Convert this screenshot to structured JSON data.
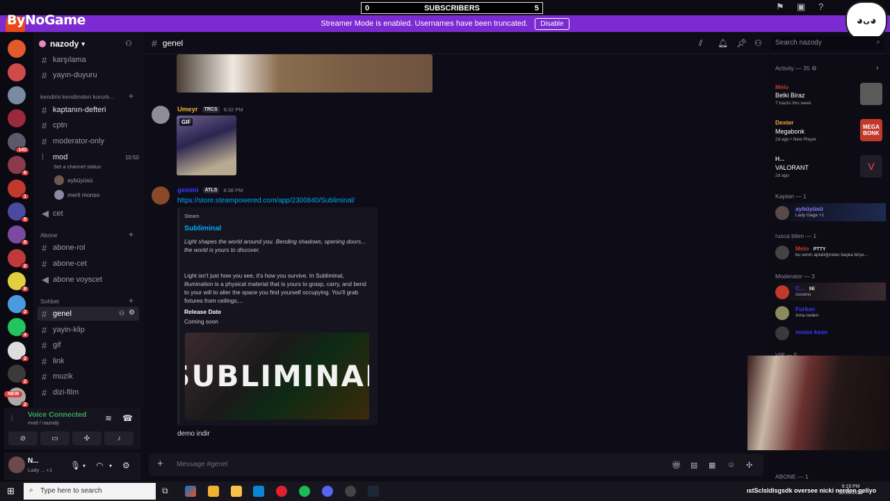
{
  "overlay": {
    "subs_left": "0",
    "subs_label": "SUBSCRIBERS",
    "subs_right": "5",
    "brand": "ByNoGame"
  },
  "banner": {
    "text": "Streamer Mode is enabled. Usernames have been truncated.",
    "button": "Disable"
  },
  "server_badges": [
    "143",
    "6",
    "1",
    "8",
    "8",
    "2",
    "8",
    "2",
    "4",
    "2",
    "2",
    "2"
  ],
  "server_new": "NEW",
  "guild": {
    "name": "nazody"
  },
  "channels": {
    "top": [
      {
        "name": "karşılama"
      },
      {
        "name": "yayın-duyuru"
      }
    ],
    "cat1": "kendimi kendimden korurk...",
    "cat1_items": [
      {
        "name": "kaptanın-defteri"
      },
      {
        "name": "cptn"
      },
      {
        "name": "moderator-only"
      },
      {
        "name": "mod",
        "time": "10:50",
        "status": "Set a channel status"
      }
    ],
    "voice_users": [
      {
        "name": "aybüyüsü"
      },
      {
        "name": "merli monso"
      }
    ],
    "cet": "cet",
    "cat2": "Abone",
    "cat2_items": [
      {
        "name": "abone-rol"
      },
      {
        "name": "abone-cet"
      },
      {
        "name": "abone voyscet"
      }
    ],
    "cat3": "Sohbet",
    "cat3_items": [
      {
        "name": "genel"
      },
      {
        "name": "yayin-klip"
      },
      {
        "name": "gif"
      },
      {
        "name": "link"
      },
      {
        "name": "muzik"
      },
      {
        "name": "dizi-film"
      }
    ]
  },
  "voice": {
    "title": "Voice Connected",
    "sub": "mod / nazody"
  },
  "user": {
    "name": "N...",
    "status": "Lady ... +1"
  },
  "chat": {
    "channel": "genel",
    "messages": [
      {
        "author": "Umeyr",
        "tag": "TRCS",
        "time": "8:32 PM",
        "gif_label": "GIF",
        "color": "#f0b232"
      },
      {
        "author": "gemini",
        "tag": "ATLS",
        "time": "8:38 PM",
        "color": "#3a3aff",
        "link": "https://store.steampowered.com/app/2300840/Subliminal/"
      }
    ],
    "embed": {
      "provider": "Steam",
      "title": "Subliminal",
      "description": "Light shapes the world around you. Bending shadows, opening doors... the world is yours to discover.",
      "description2": "Light isn't just how you see, it's how you survive. In Subliminal, illumination is a physical material that is yours to grasp, carry, and bend to your will to alter the space you find yourself occupying. You'll grab fixtures from ceilings,...",
      "field_name": "Release Date",
      "field_value": "Coming soon",
      "image_text": "SUBLIMINAL"
    },
    "last_message": "demo indir",
    "composer_placeholder": "Message #genel"
  },
  "search": {
    "placeholder": "Search nazody"
  },
  "members": {
    "activity_header": "Activity — 35",
    "activities": [
      {
        "name": "Melo",
        "game": "Belki Biraz",
        "sub": "7 tracks this week",
        "color": "#c0392b"
      },
      {
        "name": "Dexter",
        "game": "Megabonk",
        "sub": "2d ago  •  New Player",
        "color": "#f0b232",
        "art": "MEGA BONK"
      },
      {
        "name": "H...",
        "game": "VALORANT",
        "sub": "2d ago",
        "color": "#ddd"
      }
    ],
    "groups": [
      {
        "header": "Kaptan — 1",
        "rows": [
          {
            "name": "aybüyüsü",
            "status": "Lady Gaga +1",
            "color": "#8a7aff"
          }
        ]
      },
      {
        "header": "rusca bilen — 1",
        "rows": [
          {
            "name": "Melo",
            "tag": "PTTY",
            "status": "bu senin aptallığından başka birşe...",
            "color": "#c0392b"
          }
        ]
      },
      {
        "header": "Moderator — 3",
        "rows": [
          {
            "name": "C...",
            "tag": "9E",
            "status": "/covens",
            "color": "#3a3aff"
          },
          {
            "name": "Furkan",
            "status": "Ama neden",
            "color": "#3a3aff"
          },
          {
            "name": "moise kean",
            "status": "",
            "color": "#3a3aff"
          }
        ]
      },
      {
        "header": "VIP — 5",
        "rows": []
      },
      {
        "header": "ABONE — 1",
        "rows": []
      }
    ]
  },
  "taskbar": {
    "search_placeholder": "Type here to search",
    "ticker": "ıstSclsldlsgsdk oversee nicki nerden geliyo",
    "clock_time": "9:19 PM",
    "clock_date": "12/28/2025"
  }
}
